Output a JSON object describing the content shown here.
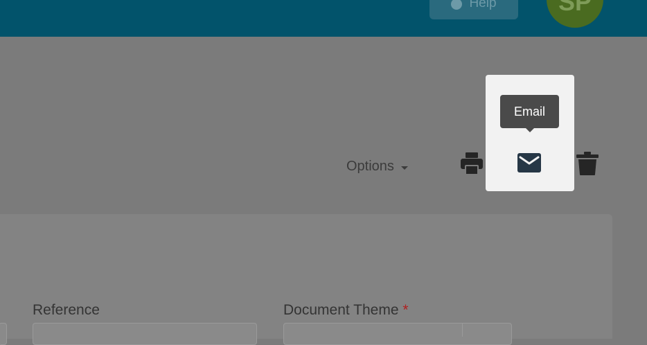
{
  "topbar": {
    "help_label": "Help",
    "avatar_initials": "SP"
  },
  "toolbar": {
    "options_label": "Options",
    "email_tooltip": "Email"
  },
  "form": {
    "reference_label": "Reference",
    "document_theme_label": "Document Theme",
    "required_mark": "*"
  }
}
